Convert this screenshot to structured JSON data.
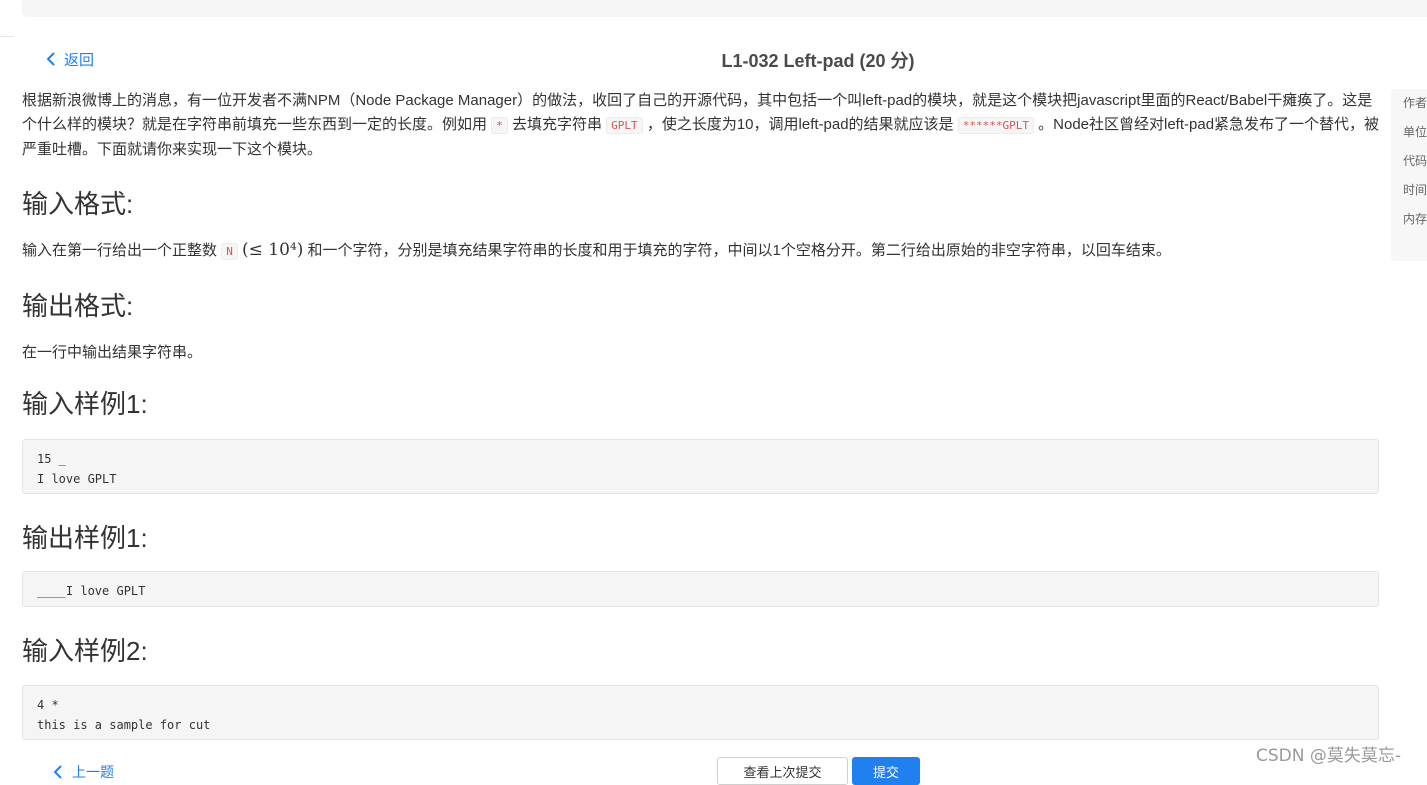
{
  "nav": {
    "back_label": "返回",
    "title": "L1-032 Left-pad (20 分)"
  },
  "problem": {
    "description_part1": "根据新浪微博上的消息，有一位开发者不满NPM（Node Package Manager）的做法，收回了自己的开源代码，其中包括一个叫left-pad的模块，就是这个模块把javascript里面的React/Babel干瘫痪了。这是个什么样的模块？就是在字符串前填充一些东西到一定的长度。例如用",
    "code_star": "*",
    "description_part2": "去填充字符串",
    "code_gplt": "GPLT",
    "description_part3": "，使之长度为10，调用left-pad的结果就应该是",
    "code_result": "******GPLT",
    "description_part4": "。Node社区曾经对left-pad紧急发布了一个替代，被严重吐槽。下面就请你来实现一下这个模块。",
    "input_heading": "输入格式:",
    "input_text_part1": "输入在第一行给出一个正整数",
    "input_code_n": "N",
    "input_math": "(≤ 10⁴)",
    "input_text_part2": "和一个字符，分别是填充结果字符串的长度和用于填充的字符，中间以1个空格分开。第二行给出原始的非空字符串，以回车结束。",
    "output_heading": "输出格式:",
    "output_text": "在一行中输出结果字符串。",
    "sample_in1_heading": "输入样例1:",
    "sample_in1": "15 _\nI love GPLT",
    "sample_out1_heading": "输出样例1:",
    "sample_out1": "____I love GPLT",
    "sample_in2_heading": "输入样例2:",
    "sample_in2": "4 *\nthis is a sample for cut"
  },
  "side_panel": {
    "items": [
      "作者",
      "单位",
      "代码",
      "时间",
      "内存"
    ]
  },
  "footer": {
    "prev_label": "上一题",
    "view_last_submit": "查看上次提交",
    "submit_label": "提交"
  },
  "watermark": "CSDN @莫失莫忘-",
  "colors": {
    "accent": "#2080f0",
    "code_red": "#d9534f",
    "sample_bg": "#f5f5f5"
  }
}
